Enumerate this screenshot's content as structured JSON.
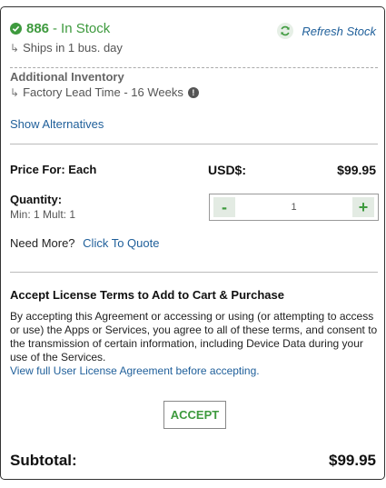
{
  "stock": {
    "quantity": "886",
    "separator": "-",
    "status": "In Stock",
    "ships": "Ships in 1 bus. day",
    "refresh_label": "Refresh Stock"
  },
  "additional_inventory": {
    "heading": "Additional Inventory",
    "lead_time": "Factory Lead Time - 16 Weeks",
    "info_glyph": "!"
  },
  "alternatives_link": "Show Alternatives",
  "pricing": {
    "price_for": "Price For: Each",
    "currency": "USD$:",
    "price": "$99.95"
  },
  "quantity": {
    "label": "Quantity:",
    "min_mult": "Min: 1 Mult: 1",
    "value": "1",
    "minus": "-",
    "plus": "+"
  },
  "need_more": {
    "label": "Need More?",
    "link": "Click To Quote"
  },
  "license": {
    "heading": "Accept License Terms to Add to Cart & Purchase",
    "body": "By accepting this Agreement or accessing or using (or attempting to access or use) the Apps or Services, you agree to all of these terms, and consent to the transmission of certain information, including Device Data during your use of the Services.",
    "link": "View full User License Agreement before accepting.",
    "accept_label": "ACCEPT"
  },
  "subtotal": {
    "label": "Subtotal:",
    "value": "$99.95"
  },
  "colors": {
    "in_stock_green": "#3e9a3e",
    "link_blue": "#1f5f9a"
  }
}
